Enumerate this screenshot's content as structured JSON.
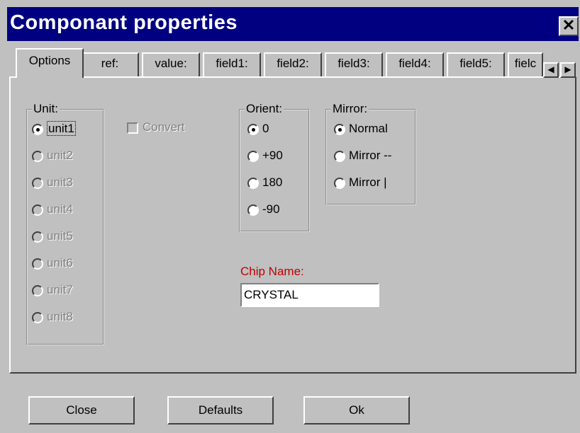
{
  "window": {
    "title": "Componant properties",
    "close_label": "✕"
  },
  "tabs": [
    {
      "label": "Options",
      "active": true
    },
    {
      "label": "ref:"
    },
    {
      "label": "value:"
    },
    {
      "label": "field1:"
    },
    {
      "label": "field2:"
    },
    {
      "label": "field3:"
    },
    {
      "label": "field4:"
    },
    {
      "label": "field5:"
    },
    {
      "label": "fielc"
    }
  ],
  "tab_scroll": {
    "left": "◀",
    "right": "▶"
  },
  "unit_group": {
    "legend": "Unit:",
    "options": [
      "unit1",
      "unit2",
      "unit3",
      "unit4",
      "unit5",
      "unit6",
      "unit7",
      "unit8"
    ],
    "selected": "unit1"
  },
  "convert": {
    "label": "Convert",
    "checked": false,
    "enabled": false
  },
  "orient_group": {
    "legend": "Orient:",
    "options": [
      "0",
      "+90",
      "180",
      "-90"
    ],
    "selected": "0"
  },
  "mirror_group": {
    "legend": "Mirror:",
    "options": [
      "Normal",
      "Mirror --",
      "Mirror |"
    ],
    "selected": "Normal"
  },
  "chip_name": {
    "label": "Chip Name:",
    "value": "CRYSTAL"
  },
  "buttons": {
    "close": "Close",
    "defaults": "Defaults",
    "ok": "Ok"
  },
  "colors": {
    "title_bar": "#000080",
    "face": "#c0c0c0",
    "chip_label": "#c00000"
  }
}
